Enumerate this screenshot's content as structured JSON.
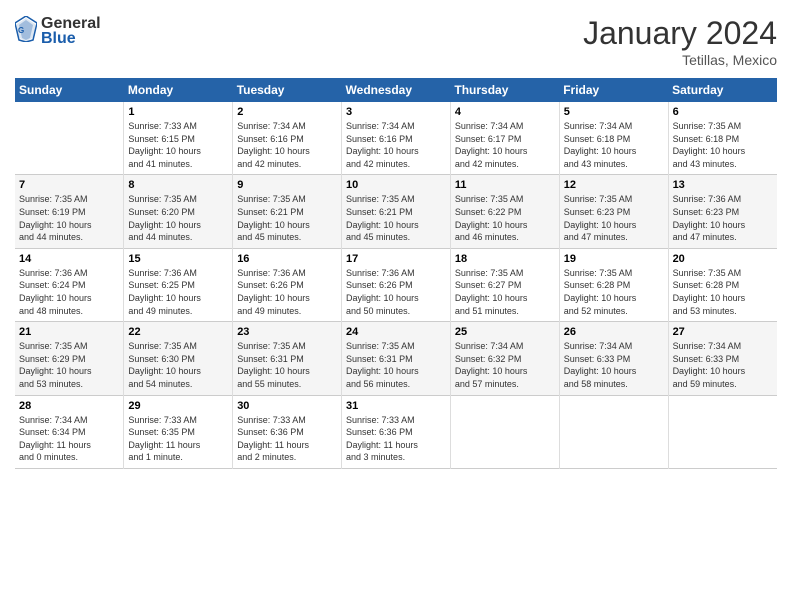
{
  "header": {
    "logo_line1": "General",
    "logo_line2": "Blue",
    "month": "January 2024",
    "location": "Tetillas, Mexico"
  },
  "weekdays": [
    "Sunday",
    "Monday",
    "Tuesday",
    "Wednesday",
    "Thursday",
    "Friday",
    "Saturday"
  ],
  "weeks": [
    [
      {
        "day": "",
        "info": ""
      },
      {
        "day": "1",
        "info": "Sunrise: 7:33 AM\nSunset: 6:15 PM\nDaylight: 10 hours\nand 41 minutes."
      },
      {
        "day": "2",
        "info": "Sunrise: 7:34 AM\nSunset: 6:16 PM\nDaylight: 10 hours\nand 42 minutes."
      },
      {
        "day": "3",
        "info": "Sunrise: 7:34 AM\nSunset: 6:16 PM\nDaylight: 10 hours\nand 42 minutes."
      },
      {
        "day": "4",
        "info": "Sunrise: 7:34 AM\nSunset: 6:17 PM\nDaylight: 10 hours\nand 42 minutes."
      },
      {
        "day": "5",
        "info": "Sunrise: 7:34 AM\nSunset: 6:18 PM\nDaylight: 10 hours\nand 43 minutes."
      },
      {
        "day": "6",
        "info": "Sunrise: 7:35 AM\nSunset: 6:18 PM\nDaylight: 10 hours\nand 43 minutes."
      }
    ],
    [
      {
        "day": "7",
        "info": "Sunrise: 7:35 AM\nSunset: 6:19 PM\nDaylight: 10 hours\nand 44 minutes."
      },
      {
        "day": "8",
        "info": "Sunrise: 7:35 AM\nSunset: 6:20 PM\nDaylight: 10 hours\nand 44 minutes."
      },
      {
        "day": "9",
        "info": "Sunrise: 7:35 AM\nSunset: 6:21 PM\nDaylight: 10 hours\nand 45 minutes."
      },
      {
        "day": "10",
        "info": "Sunrise: 7:35 AM\nSunset: 6:21 PM\nDaylight: 10 hours\nand 45 minutes."
      },
      {
        "day": "11",
        "info": "Sunrise: 7:35 AM\nSunset: 6:22 PM\nDaylight: 10 hours\nand 46 minutes."
      },
      {
        "day": "12",
        "info": "Sunrise: 7:35 AM\nSunset: 6:23 PM\nDaylight: 10 hours\nand 47 minutes."
      },
      {
        "day": "13",
        "info": "Sunrise: 7:36 AM\nSunset: 6:23 PM\nDaylight: 10 hours\nand 47 minutes."
      }
    ],
    [
      {
        "day": "14",
        "info": "Sunrise: 7:36 AM\nSunset: 6:24 PM\nDaylight: 10 hours\nand 48 minutes."
      },
      {
        "day": "15",
        "info": "Sunrise: 7:36 AM\nSunset: 6:25 PM\nDaylight: 10 hours\nand 49 minutes."
      },
      {
        "day": "16",
        "info": "Sunrise: 7:36 AM\nSunset: 6:26 PM\nDaylight: 10 hours\nand 49 minutes."
      },
      {
        "day": "17",
        "info": "Sunrise: 7:36 AM\nSunset: 6:26 PM\nDaylight: 10 hours\nand 50 minutes."
      },
      {
        "day": "18",
        "info": "Sunrise: 7:35 AM\nSunset: 6:27 PM\nDaylight: 10 hours\nand 51 minutes."
      },
      {
        "day": "19",
        "info": "Sunrise: 7:35 AM\nSunset: 6:28 PM\nDaylight: 10 hours\nand 52 minutes."
      },
      {
        "day": "20",
        "info": "Sunrise: 7:35 AM\nSunset: 6:28 PM\nDaylight: 10 hours\nand 53 minutes."
      }
    ],
    [
      {
        "day": "21",
        "info": "Sunrise: 7:35 AM\nSunset: 6:29 PM\nDaylight: 10 hours\nand 53 minutes."
      },
      {
        "day": "22",
        "info": "Sunrise: 7:35 AM\nSunset: 6:30 PM\nDaylight: 10 hours\nand 54 minutes."
      },
      {
        "day": "23",
        "info": "Sunrise: 7:35 AM\nSunset: 6:31 PM\nDaylight: 10 hours\nand 55 minutes."
      },
      {
        "day": "24",
        "info": "Sunrise: 7:35 AM\nSunset: 6:31 PM\nDaylight: 10 hours\nand 56 minutes."
      },
      {
        "day": "25",
        "info": "Sunrise: 7:34 AM\nSunset: 6:32 PM\nDaylight: 10 hours\nand 57 minutes."
      },
      {
        "day": "26",
        "info": "Sunrise: 7:34 AM\nSunset: 6:33 PM\nDaylight: 10 hours\nand 58 minutes."
      },
      {
        "day": "27",
        "info": "Sunrise: 7:34 AM\nSunset: 6:33 PM\nDaylight: 10 hours\nand 59 minutes."
      }
    ],
    [
      {
        "day": "28",
        "info": "Sunrise: 7:34 AM\nSunset: 6:34 PM\nDaylight: 11 hours\nand 0 minutes."
      },
      {
        "day": "29",
        "info": "Sunrise: 7:33 AM\nSunset: 6:35 PM\nDaylight: 11 hours\nand 1 minute."
      },
      {
        "day": "30",
        "info": "Sunrise: 7:33 AM\nSunset: 6:36 PM\nDaylight: 11 hours\nand 2 minutes."
      },
      {
        "day": "31",
        "info": "Sunrise: 7:33 AM\nSunset: 6:36 PM\nDaylight: 11 hours\nand 3 minutes."
      },
      {
        "day": "",
        "info": ""
      },
      {
        "day": "",
        "info": ""
      },
      {
        "day": "",
        "info": ""
      }
    ]
  ]
}
